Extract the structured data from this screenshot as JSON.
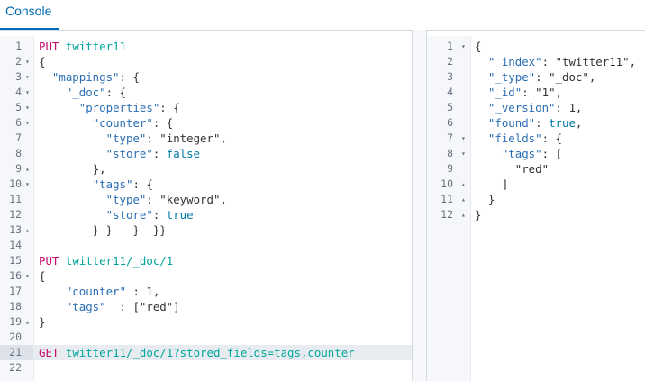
{
  "console": {
    "tab_label": "Console"
  },
  "left_editor": {
    "lines": [
      {
        "n": "1",
        "fold": "",
        "html": "<span class=\"m\">PUT</span> <span class=\"u\">twitter11</span>"
      },
      {
        "n": "2",
        "fold": "▾",
        "html": "<span class=\"p\">{</span>"
      },
      {
        "n": "3",
        "fold": "▾",
        "html": "  <span class=\"k\">\"mappings\"</span><span class=\"p\">: {</span>"
      },
      {
        "n": "4",
        "fold": "▾",
        "html": "    <span class=\"k\">\"_doc\"</span><span class=\"p\">: {</span>"
      },
      {
        "n": "5",
        "fold": "▾",
        "html": "      <span class=\"k\">\"properties\"</span><span class=\"p\">: {</span>"
      },
      {
        "n": "6",
        "fold": "▾",
        "html": "        <span class=\"k\">\"counter\"</span><span class=\"p\">: {</span>"
      },
      {
        "n": "7",
        "fold": "",
        "html": "          <span class=\"k\">\"type\"</span><span class=\"p\">: </span><span class=\"s\">\"integer\"</span><span class=\"p\">,</span>"
      },
      {
        "n": "8",
        "fold": "",
        "html": "          <span class=\"k\">\"store\"</span><span class=\"p\">: </span><span class=\"c\">false</span>"
      },
      {
        "n": "9",
        "fold": "▴",
        "html": "        <span class=\"p\">},</span>"
      },
      {
        "n": "10",
        "fold": "▾",
        "html": "        <span class=\"k\">\"tags\"</span><span class=\"p\">: {</span>"
      },
      {
        "n": "11",
        "fold": "",
        "html": "          <span class=\"k\">\"type\"</span><span class=\"p\">: </span><span class=\"s\">\"keyword\"</span><span class=\"p\">,</span>"
      },
      {
        "n": "12",
        "fold": "",
        "html": "          <span class=\"k\">\"store\"</span><span class=\"p\">: </span><span class=\"c\">true</span>"
      },
      {
        "n": "13",
        "fold": "▴",
        "html": "        <span class=\"p\">} }   }  }}</span>"
      },
      {
        "n": "14",
        "fold": "",
        "html": ""
      },
      {
        "n": "15",
        "fold": "",
        "html": "<span class=\"m\">PUT</span> <span class=\"u\">twitter11/_doc/1</span>"
      },
      {
        "n": "16",
        "fold": "▾",
        "html": "<span class=\"p\">{</span>"
      },
      {
        "n": "17",
        "fold": "",
        "html": "    <span class=\"k\">\"counter\"</span> <span class=\"p\">: </span><span class=\"n\">1</span><span class=\"p\">,</span>"
      },
      {
        "n": "18",
        "fold": "",
        "html": "    <span class=\"k\">\"tags\"</span>  <span class=\"p\">: [</span><span class=\"s\">\"red\"</span><span class=\"p\">]</span>"
      },
      {
        "n": "19",
        "fold": "▴",
        "html": "<span class=\"p\">}</span>"
      },
      {
        "n": "20",
        "fold": "",
        "html": ""
      },
      {
        "n": "21",
        "fold": "",
        "html": "<span class=\"m\">GET</span> <span class=\"u\">twitter11/_doc/1?stored_fields=tags,counter</span>",
        "active": true
      },
      {
        "n": "22",
        "fold": "",
        "html": ""
      }
    ]
  },
  "right_editor": {
    "lines": [
      {
        "n": "1",
        "fold": "▾",
        "html": "<span class=\"p\">{</span>"
      },
      {
        "n": "2",
        "fold": "",
        "html": "  <span class=\"k\">\"_index\"</span><span class=\"p\">: </span><span class=\"s\">\"twitter11\"</span><span class=\"p\">,</span>"
      },
      {
        "n": "3",
        "fold": "",
        "html": "  <span class=\"k\">\"_type\"</span><span class=\"p\">: </span><span class=\"s\">\"_doc\"</span><span class=\"p\">,</span>"
      },
      {
        "n": "4",
        "fold": "",
        "html": "  <span class=\"k\">\"_id\"</span><span class=\"p\">: </span><span class=\"s\">\"1\"</span><span class=\"p\">,</span>"
      },
      {
        "n": "5",
        "fold": "",
        "html": "  <span class=\"k\">\"_version\"</span><span class=\"p\">: </span><span class=\"n\">1</span><span class=\"p\">,</span>"
      },
      {
        "n": "6",
        "fold": "",
        "html": "  <span class=\"k\">\"found\"</span><span class=\"p\">: </span><span class=\"c\">true</span><span class=\"p\">,</span>"
      },
      {
        "n": "7",
        "fold": "▾",
        "html": "  <span class=\"k\">\"fields\"</span><span class=\"p\">: {</span>"
      },
      {
        "n": "8",
        "fold": "▾",
        "html": "    <span class=\"k\">\"tags\"</span><span class=\"p\">: [</span>"
      },
      {
        "n": "9",
        "fold": "",
        "html": "      <span class=\"s\">\"red\"</span>"
      },
      {
        "n": "10",
        "fold": "▴",
        "html": "    <span class=\"p\">]</span>"
      },
      {
        "n": "11",
        "fold": "▴",
        "html": "  <span class=\"p\">}</span>"
      },
      {
        "n": "12",
        "fold": "▴",
        "html": "<span class=\"p\">}</span>"
      }
    ]
  },
  "icons": {
    "run": "play-icon",
    "settings": "wrench-icon"
  },
  "colors": {
    "accent": "#006bb4",
    "method": "#c80a68",
    "url": "#00a69b",
    "key": "#2a6eb4",
    "constant": "#0079a5",
    "run": "#3ebe2c"
  }
}
